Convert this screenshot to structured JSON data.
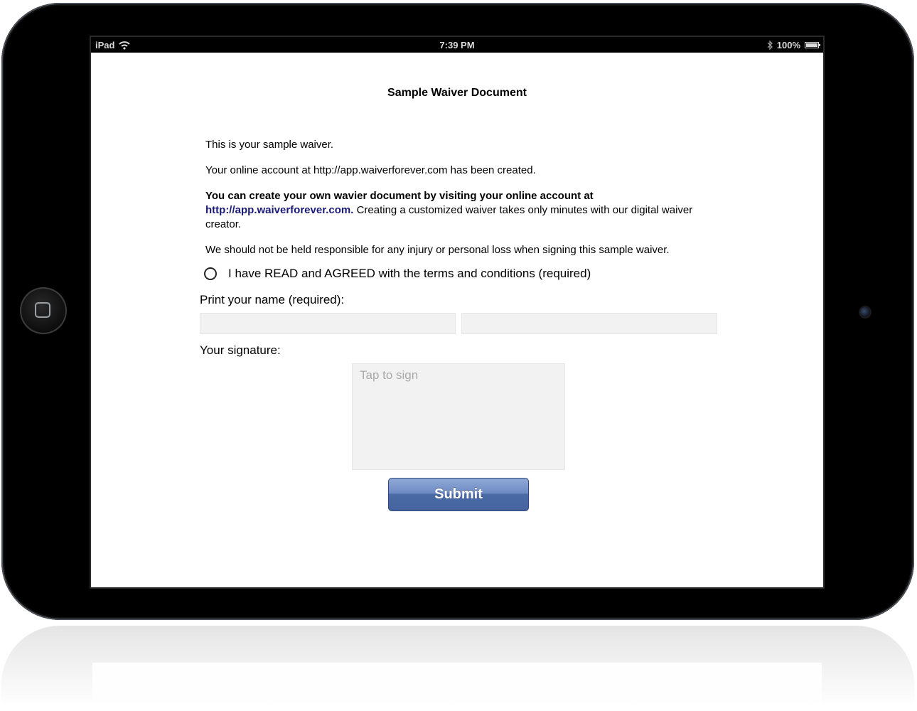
{
  "status_bar": {
    "device": "iPad",
    "time": "7:39 PM",
    "battery": "100%",
    "battery_level": 1.0
  },
  "document": {
    "title": "Sample Waiver Document",
    "para1": "This is your sample waiver.",
    "para2": "Your online account at http://app.waiverforever.com has been created.",
    "para3_bold": "You can create your own wavier document by visiting your online account at",
    "para3_link": "http://app.waiverforever.com.",
    "para3_rest": "Creating a customized waiver takes only minutes with our digital waiver creator.",
    "para4": "We should not be held responsible for any injury or personal loss when signing this sample waiver."
  },
  "form": {
    "agree_label": "I have READ and AGREED with the terms and conditions (required)",
    "name_label": "Print your name (required):",
    "signature_label": "Your signature:",
    "signature_placeholder": "Tap to sign",
    "submit_label": "Submit"
  },
  "colors": {
    "link": "#1a1a7a",
    "submit_bg": "#4a6aa5",
    "field_bg": "#f2f2f2"
  }
}
